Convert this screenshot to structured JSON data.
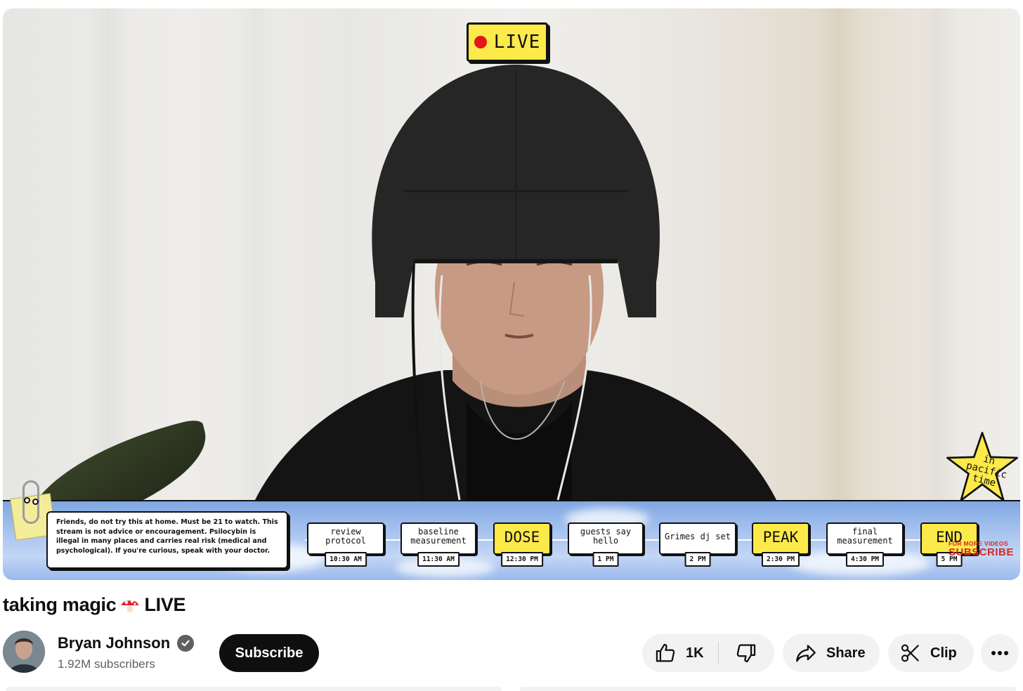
{
  "video": {
    "live_badge": "LIVE",
    "disclaimer": "Friends, do not try this at home. Must be 21 to watch. This stream is not advice or encouragement. Psilocybin is illegal in many places and carries real risk (medical and psychological). If you're curious, speak with your doctor.",
    "timeline": [
      {
        "label": "review protocol",
        "time": "10:30 AM",
        "highlight": false
      },
      {
        "label": "baseline measurement",
        "time": "11:30 AM",
        "highlight": false
      },
      {
        "label": "DOSE",
        "time": "12:30 PM",
        "highlight": true
      },
      {
        "label": "guests say hello",
        "time": "1 PM",
        "highlight": false
      },
      {
        "label": "Grimes dj set",
        "time": "2 PM",
        "highlight": false
      },
      {
        "label": "PEAK",
        "time": "2:30 PM",
        "highlight": true
      },
      {
        "label": "final measurement",
        "time": "4:30 PM",
        "highlight": false
      },
      {
        "label": "END",
        "time": "5 PM",
        "highlight": true
      }
    ],
    "more_videos": "FOR MORE VIDEOS",
    "subscribe_overlay": "SUBSCRIBE",
    "time_zone_note": "in pacific time",
    "colors": {
      "badge_yellow": "#fce94a",
      "live_red": "#e4151b",
      "sky_blue": "#9ab9ec"
    }
  },
  "title": {
    "text": "taking magic",
    "suffix": "LIVE",
    "emoji": "mushroom-icon"
  },
  "channel": {
    "name": "Bryan Johnson",
    "subscribers": "1.92M subscribers",
    "verified": true
  },
  "actions": {
    "subscribe": "Subscribe",
    "like_count": "1K",
    "share": "Share",
    "clip": "Clip"
  }
}
